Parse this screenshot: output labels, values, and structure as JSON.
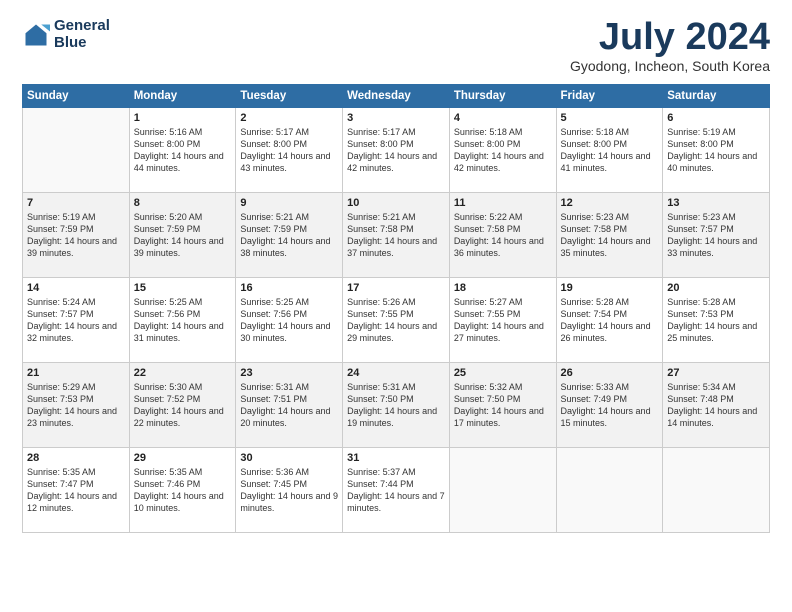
{
  "logo": {
    "line1": "General",
    "line2": "Blue"
  },
  "title": "July 2024",
  "location": "Gyodong, Incheon, South Korea",
  "weekdays": [
    "Sunday",
    "Monday",
    "Tuesday",
    "Wednesday",
    "Thursday",
    "Friday",
    "Saturday"
  ],
  "weeks": [
    [
      {
        "day": "",
        "sunrise": "",
        "sunset": "",
        "daylight": ""
      },
      {
        "day": "1",
        "sunrise": "Sunrise: 5:16 AM",
        "sunset": "Sunset: 8:00 PM",
        "daylight": "Daylight: 14 hours and 44 minutes."
      },
      {
        "day": "2",
        "sunrise": "Sunrise: 5:17 AM",
        "sunset": "Sunset: 8:00 PM",
        "daylight": "Daylight: 14 hours and 43 minutes."
      },
      {
        "day": "3",
        "sunrise": "Sunrise: 5:17 AM",
        "sunset": "Sunset: 8:00 PM",
        "daylight": "Daylight: 14 hours and 42 minutes."
      },
      {
        "day": "4",
        "sunrise": "Sunrise: 5:18 AM",
        "sunset": "Sunset: 8:00 PM",
        "daylight": "Daylight: 14 hours and 42 minutes."
      },
      {
        "day": "5",
        "sunrise": "Sunrise: 5:18 AM",
        "sunset": "Sunset: 8:00 PM",
        "daylight": "Daylight: 14 hours and 41 minutes."
      },
      {
        "day": "6",
        "sunrise": "Sunrise: 5:19 AM",
        "sunset": "Sunset: 8:00 PM",
        "daylight": "Daylight: 14 hours and 40 minutes."
      }
    ],
    [
      {
        "day": "7",
        "sunrise": "Sunrise: 5:19 AM",
        "sunset": "Sunset: 7:59 PM",
        "daylight": "Daylight: 14 hours and 39 minutes."
      },
      {
        "day": "8",
        "sunrise": "Sunrise: 5:20 AM",
        "sunset": "Sunset: 7:59 PM",
        "daylight": "Daylight: 14 hours and 39 minutes."
      },
      {
        "day": "9",
        "sunrise": "Sunrise: 5:21 AM",
        "sunset": "Sunset: 7:59 PM",
        "daylight": "Daylight: 14 hours and 38 minutes."
      },
      {
        "day": "10",
        "sunrise": "Sunrise: 5:21 AM",
        "sunset": "Sunset: 7:58 PM",
        "daylight": "Daylight: 14 hours and 37 minutes."
      },
      {
        "day": "11",
        "sunrise": "Sunrise: 5:22 AM",
        "sunset": "Sunset: 7:58 PM",
        "daylight": "Daylight: 14 hours and 36 minutes."
      },
      {
        "day": "12",
        "sunrise": "Sunrise: 5:23 AM",
        "sunset": "Sunset: 7:58 PM",
        "daylight": "Daylight: 14 hours and 35 minutes."
      },
      {
        "day": "13",
        "sunrise": "Sunrise: 5:23 AM",
        "sunset": "Sunset: 7:57 PM",
        "daylight": "Daylight: 14 hours and 33 minutes."
      }
    ],
    [
      {
        "day": "14",
        "sunrise": "Sunrise: 5:24 AM",
        "sunset": "Sunset: 7:57 PM",
        "daylight": "Daylight: 14 hours and 32 minutes."
      },
      {
        "day": "15",
        "sunrise": "Sunrise: 5:25 AM",
        "sunset": "Sunset: 7:56 PM",
        "daylight": "Daylight: 14 hours and 31 minutes."
      },
      {
        "day": "16",
        "sunrise": "Sunrise: 5:25 AM",
        "sunset": "Sunset: 7:56 PM",
        "daylight": "Daylight: 14 hours and 30 minutes."
      },
      {
        "day": "17",
        "sunrise": "Sunrise: 5:26 AM",
        "sunset": "Sunset: 7:55 PM",
        "daylight": "Daylight: 14 hours and 29 minutes."
      },
      {
        "day": "18",
        "sunrise": "Sunrise: 5:27 AM",
        "sunset": "Sunset: 7:55 PM",
        "daylight": "Daylight: 14 hours and 27 minutes."
      },
      {
        "day": "19",
        "sunrise": "Sunrise: 5:28 AM",
        "sunset": "Sunset: 7:54 PM",
        "daylight": "Daylight: 14 hours and 26 minutes."
      },
      {
        "day": "20",
        "sunrise": "Sunrise: 5:28 AM",
        "sunset": "Sunset: 7:53 PM",
        "daylight": "Daylight: 14 hours and 25 minutes."
      }
    ],
    [
      {
        "day": "21",
        "sunrise": "Sunrise: 5:29 AM",
        "sunset": "Sunset: 7:53 PM",
        "daylight": "Daylight: 14 hours and 23 minutes."
      },
      {
        "day": "22",
        "sunrise": "Sunrise: 5:30 AM",
        "sunset": "Sunset: 7:52 PM",
        "daylight": "Daylight: 14 hours and 22 minutes."
      },
      {
        "day": "23",
        "sunrise": "Sunrise: 5:31 AM",
        "sunset": "Sunset: 7:51 PM",
        "daylight": "Daylight: 14 hours and 20 minutes."
      },
      {
        "day": "24",
        "sunrise": "Sunrise: 5:31 AM",
        "sunset": "Sunset: 7:50 PM",
        "daylight": "Daylight: 14 hours and 19 minutes."
      },
      {
        "day": "25",
        "sunrise": "Sunrise: 5:32 AM",
        "sunset": "Sunset: 7:50 PM",
        "daylight": "Daylight: 14 hours and 17 minutes."
      },
      {
        "day": "26",
        "sunrise": "Sunrise: 5:33 AM",
        "sunset": "Sunset: 7:49 PM",
        "daylight": "Daylight: 14 hours and 15 minutes."
      },
      {
        "day": "27",
        "sunrise": "Sunrise: 5:34 AM",
        "sunset": "Sunset: 7:48 PM",
        "daylight": "Daylight: 14 hours and 14 minutes."
      }
    ],
    [
      {
        "day": "28",
        "sunrise": "Sunrise: 5:35 AM",
        "sunset": "Sunset: 7:47 PM",
        "daylight": "Daylight: 14 hours and 12 minutes."
      },
      {
        "day": "29",
        "sunrise": "Sunrise: 5:35 AM",
        "sunset": "Sunset: 7:46 PM",
        "daylight": "Daylight: 14 hours and 10 minutes."
      },
      {
        "day": "30",
        "sunrise": "Sunrise: 5:36 AM",
        "sunset": "Sunset: 7:45 PM",
        "daylight": "Daylight: 14 hours and 9 minutes."
      },
      {
        "day": "31",
        "sunrise": "Sunrise: 5:37 AM",
        "sunset": "Sunset: 7:44 PM",
        "daylight": "Daylight: 14 hours and 7 minutes."
      },
      {
        "day": "",
        "sunrise": "",
        "sunset": "",
        "daylight": ""
      },
      {
        "day": "",
        "sunrise": "",
        "sunset": "",
        "daylight": ""
      },
      {
        "day": "",
        "sunrise": "",
        "sunset": "",
        "daylight": ""
      }
    ]
  ]
}
